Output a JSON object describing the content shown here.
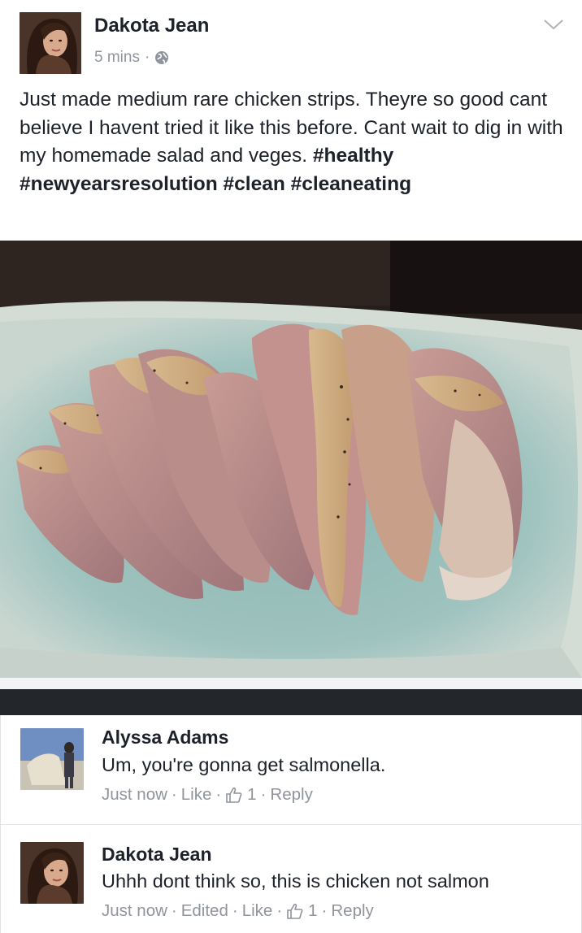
{
  "post": {
    "author": "Dakota Jean",
    "time": "5 mins",
    "meta_separator": "·",
    "privacy_icon": "globe-icon",
    "menu_icon": "chevron-down-icon",
    "text": "Just made medium rare chicken strips. Theyre so good cant believe I havent tried it like this before. Cant wait to dig in with my homemade salad and veges.",
    "hashtags": "#healthy #newyearsresolution #clean #cleaneating"
  },
  "comments": [
    {
      "author": "Alyssa Adams",
      "text": "Um, you're gonna get salmonella.",
      "time": "Just now",
      "like_label": "Like",
      "reaction_count": "1",
      "reply_label": "Reply"
    },
    {
      "author": "Dakota Jean",
      "text": "Uhhh dont think so, this is chicken not salmon",
      "time": "Just now",
      "edited_label": "Edited",
      "like_label": "Like",
      "reaction_count": "1",
      "reply_label": "Reply"
    }
  ],
  "icons": {
    "reaction": "thumbs-up-icon",
    "privacy": "globe-icon"
  },
  "colors": {
    "text": "#1d2129",
    "meta_gray": "#90949c",
    "separator_dark": "#23262b"
  }
}
